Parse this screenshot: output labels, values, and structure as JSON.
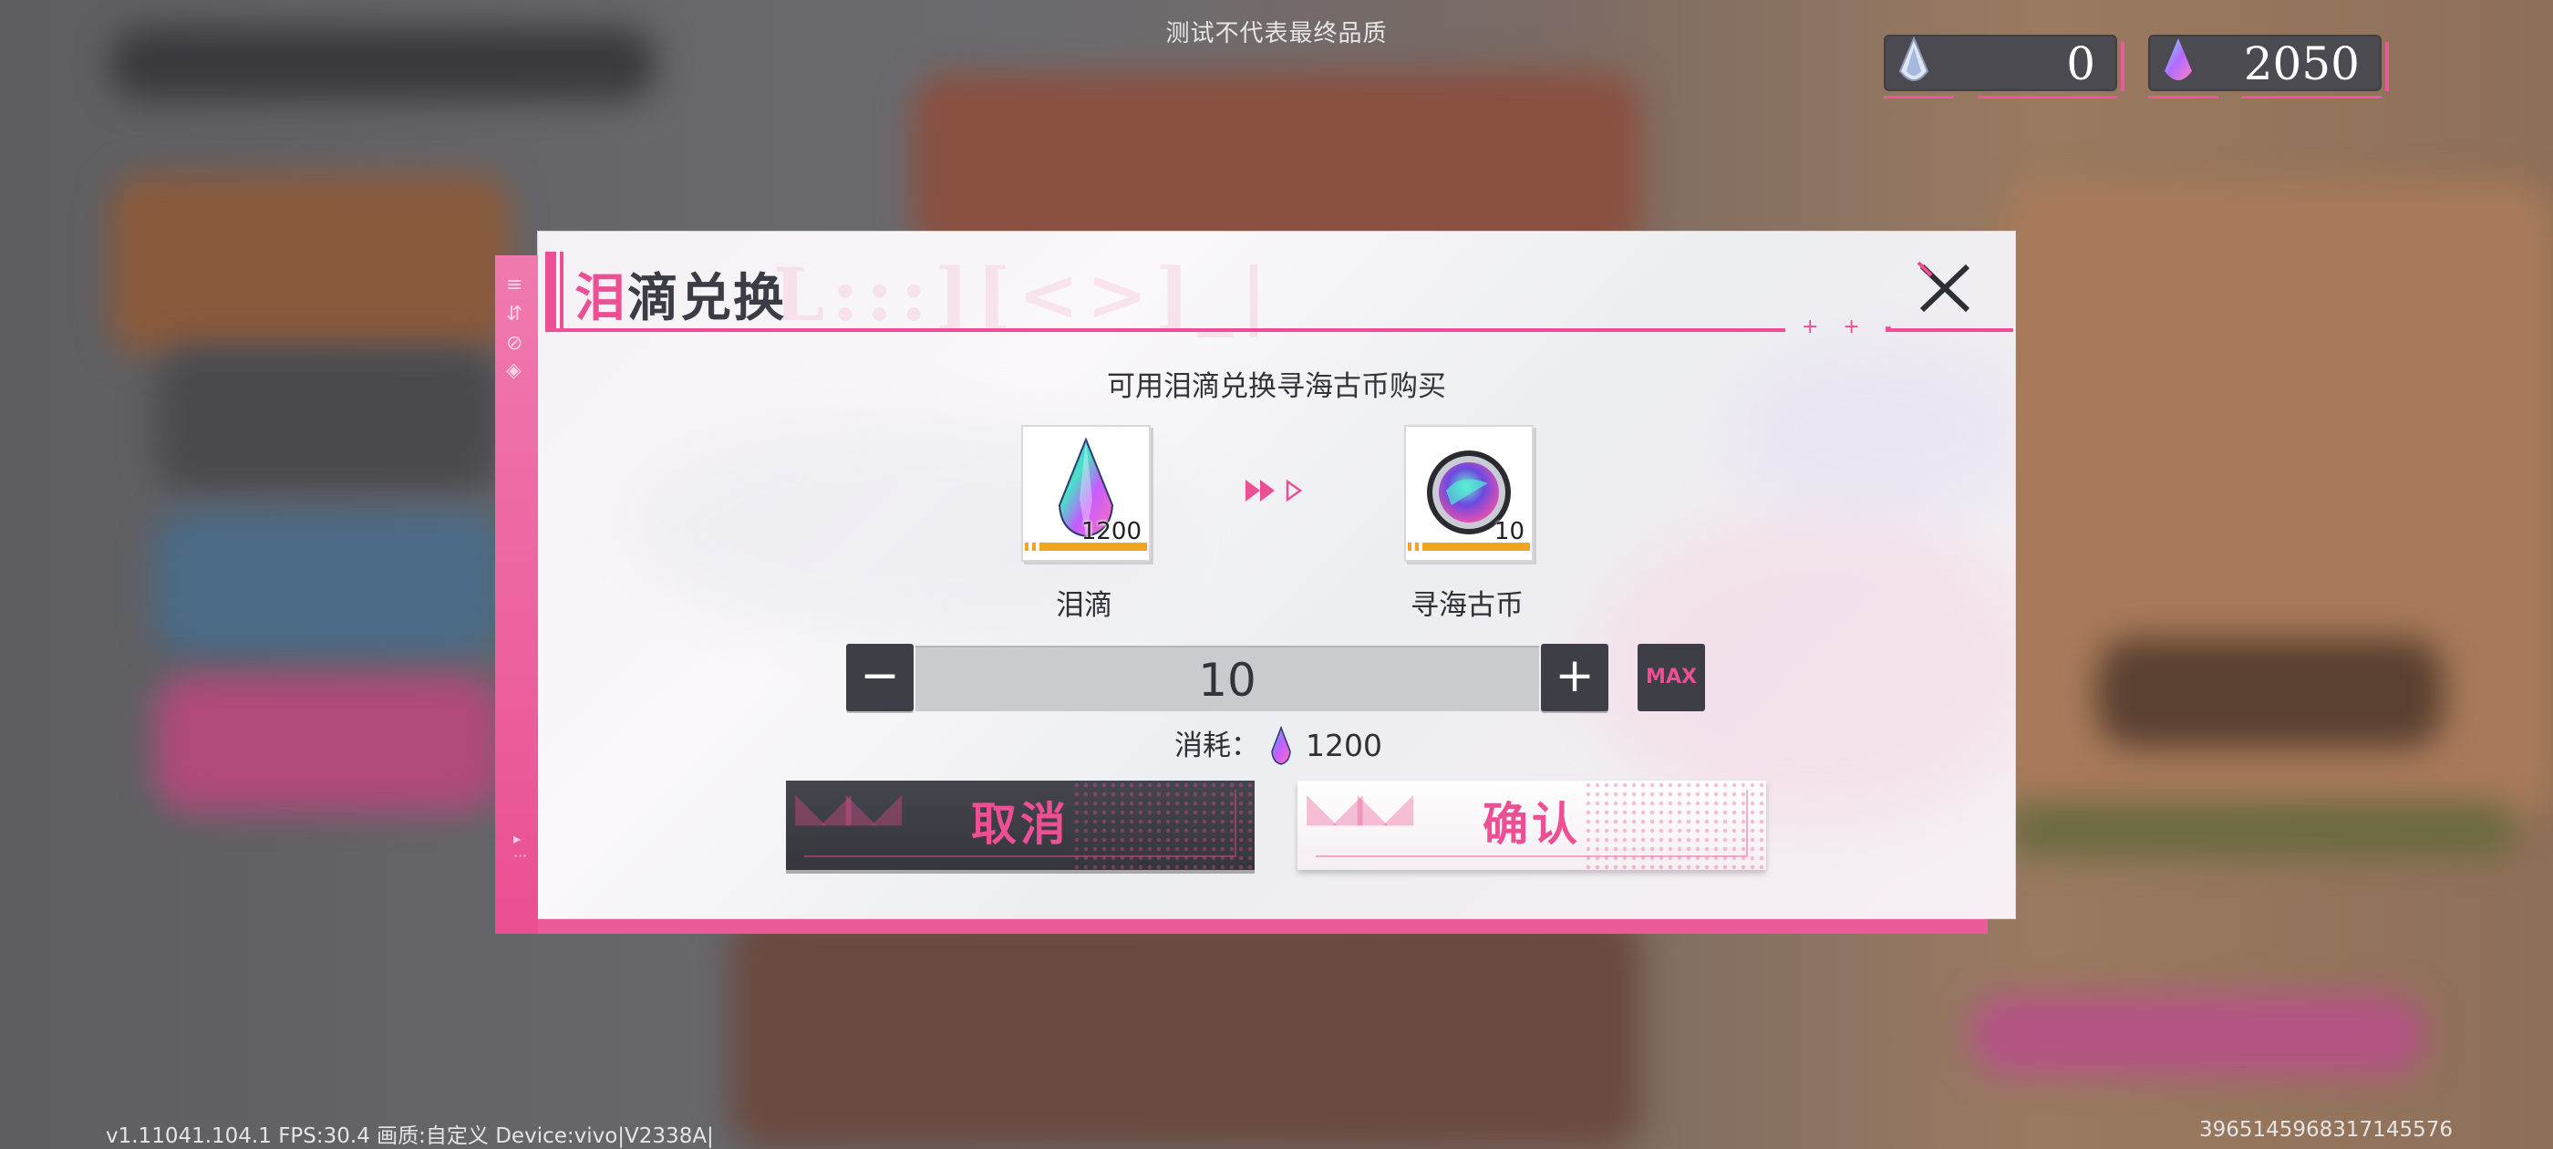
{
  "watermark": "测试不代表最终品质",
  "currencies": [
    {
      "icon": "tear-crystal-icon",
      "value": "0"
    },
    {
      "icon": "rainbow-crystal-icon",
      "value": "2050"
    }
  ],
  "dialog": {
    "title_first": "泪",
    "title_rest": "滴兑换",
    "subtitle": "可用泪滴兑换寻海古币购买",
    "from_item": {
      "name": "泪滴",
      "count": "1200",
      "icon": "teardrop-gem-icon"
    },
    "to_item": {
      "name": "寻海古币",
      "count": "10",
      "icon": "sea-coin-icon"
    },
    "quantity": "10",
    "minus_label": "−",
    "plus_label": "+",
    "max_label": "MAX",
    "cost_label": "消耗：",
    "cost_value": "1200",
    "cancel_label": "取消",
    "confirm_label": "确认"
  },
  "footer": {
    "left": "v1.11041.104.1 FPS:30.4 画质:自定义 Device:vivo|V2338A|",
    "right": "3965145968317145576"
  },
  "colors": {
    "accent": "#ec4f93",
    "button_dark": "#3e3e46"
  }
}
